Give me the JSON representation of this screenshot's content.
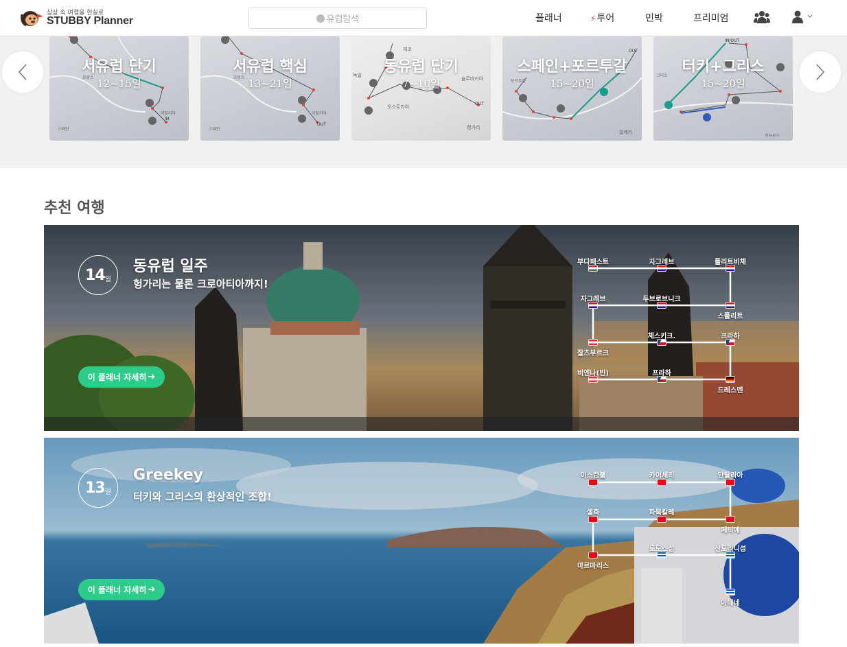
{
  "header": {
    "logo_tagline": "상상 속 여행을 현실로",
    "logo_name": "STUBBY Planner",
    "search_placeholder": "유럽탐색",
    "nav": {
      "planner": "플래너",
      "tour": "투어",
      "stay": "민박",
      "premium": "프리미엄"
    },
    "accent": "#e5413b"
  },
  "carousel": {
    "cards": [
      {
        "title": "서유럽 단기",
        "days": "12~15일"
      },
      {
        "title": "서유럽 핵심",
        "days": "13~21일"
      },
      {
        "title": "동유럽 단기",
        "days": "7~10일"
      },
      {
        "title": "스페인+포르투갈",
        "days": "15~20일"
      },
      {
        "title": "터키+그리스",
        "days": "15~20일"
      }
    ],
    "map_labels": {
      "c1": [
        "프랑스",
        "이탈리아",
        "IN",
        "스페인"
      ],
      "c2": [
        "프랑스",
        "이탈리아",
        "OUT",
        "스페인"
      ],
      "c3": [
        "체코",
        "독일",
        "슬로바키아",
        "오스트리아",
        "OUT",
        "헝가리"
      ],
      "c4": [
        "OUT",
        "포르투갈",
        "알제리"
      ],
      "c5": [
        "IN/OUT",
        "그리스",
        "키프로스"
      ]
    }
  },
  "recommended": {
    "title": "추천 여행",
    "detail_label": "이 플래너 자세히",
    "trips": [
      {
        "days": "14",
        "unit": "일",
        "title": "동유럽 일주",
        "subtitle": "헝가리는 물론 크로아티아까지!",
        "cities": [
          "부다페스트",
          "자그레브",
          "플리트비체",
          "자그레브",
          "두브로브니크",
          "스플리트",
          "체스키크.",
          "프라하",
          "잘츠부르크",
          "비엔나(빈)",
          "프라하",
          "드레스덴"
        ]
      },
      {
        "days": "13",
        "unit": "일",
        "title": "Greekey",
        "subtitle": "터키와 그리스의 환상적인 조합!",
        "cities": [
          "이스탄불",
          "카이세리",
          "안탈리아",
          "셀축",
          "파묵칼레",
          "페티예",
          "마르마리스",
          "로도스섬",
          "산토리니섬",
          "아테네"
        ]
      }
    ],
    "accent": "#2dcc8a"
  }
}
